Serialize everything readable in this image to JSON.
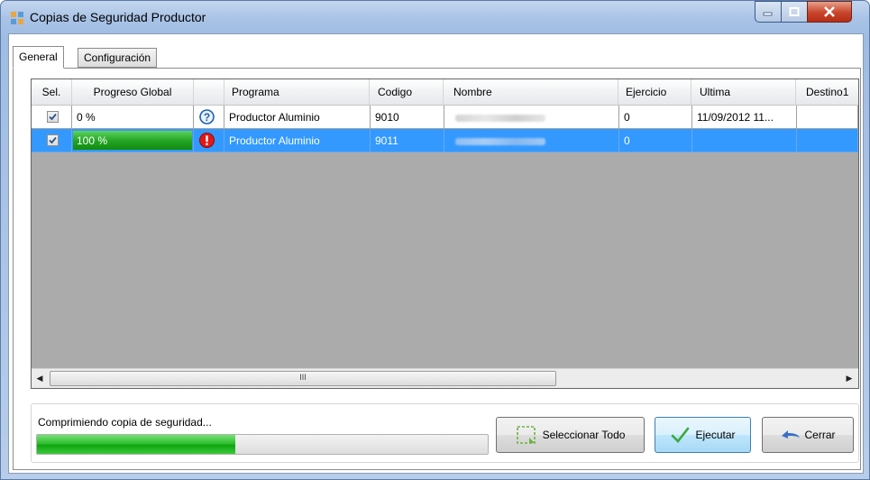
{
  "window": {
    "title": "Copias de Seguridad Productor"
  },
  "tabs": [
    {
      "label": "General",
      "active": true
    },
    {
      "label": "Configuración",
      "active": false
    }
  ],
  "grid": {
    "columns": [
      "Sel.",
      "Progreso Global",
      "",
      "Programa",
      "Codigo",
      "Nombre",
      "Ejercicio",
      "Ultima",
      "Destino1"
    ],
    "rows": [
      {
        "selected_checkbox": true,
        "progress_text": "0 %",
        "progress_fraction": 0.0,
        "status_icon": "question-icon",
        "programa": "Productor Aluminio",
        "codigo": "9010",
        "nombre_redacted": true,
        "ejercicio": "0",
        "ultima": "11/09/2012 11...",
        "destino1": "",
        "row_selected": false
      },
      {
        "selected_checkbox": true,
        "progress_text": "100 %",
        "progress_fraction": 1.0,
        "status_icon": "error-icon",
        "programa": "Productor Aluminio",
        "codigo": "9011",
        "nombre_redacted": true,
        "ejercicio": "0",
        "ultima": "",
        "destino1": "",
        "row_selected": true
      }
    ],
    "scroll_thumb_glyph": "III"
  },
  "status": {
    "label": "Comprimiendo copia de seguridad...",
    "progress_fraction": 0.44
  },
  "buttons": {
    "select_all": "Seleccionar Todo",
    "execute": "Ejecutar",
    "close": "Cerrar"
  },
  "colors": {
    "selection": "#3399ff",
    "progress_green": "#21a321",
    "grid_background": "#ababab"
  }
}
